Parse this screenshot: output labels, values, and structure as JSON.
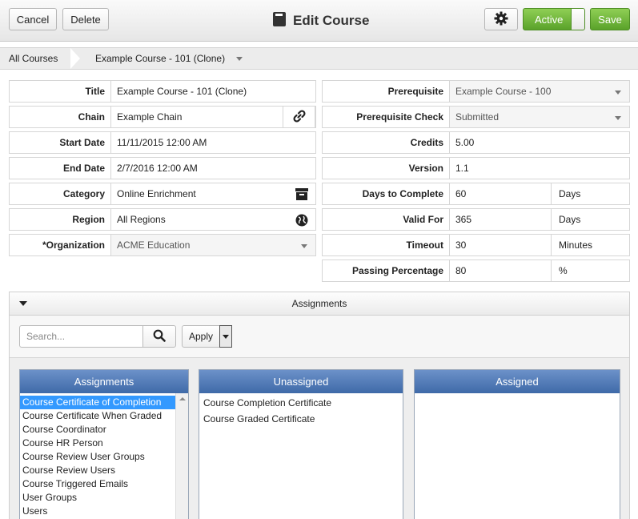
{
  "header": {
    "cancel_label": "Cancel",
    "delete_label": "Delete",
    "title": "Edit Course",
    "active_label": "Active",
    "save_label": "Save"
  },
  "breadcrumb": {
    "root": "All Courses",
    "current": "Example Course - 101 (Clone)"
  },
  "form_left": [
    {
      "label": "Title",
      "value": "Example Course - 101 (Clone)",
      "kind": "text"
    },
    {
      "label": "Chain",
      "value": "Example Chain",
      "kind": "text",
      "icon": "link-icon"
    },
    {
      "label": "Start Date",
      "value": "11/11/2015 12:00 AM",
      "kind": "text"
    },
    {
      "label": "End Date",
      "value": "2/7/2016 12:00 AM",
      "kind": "text"
    },
    {
      "label": "Category",
      "value": "Online Enrichment",
      "kind": "text",
      "icon": "archive-icon"
    },
    {
      "label": "Region",
      "value": "All Regions",
      "kind": "text",
      "icon": "globe-icon"
    },
    {
      "label": "*Organization",
      "value": "ACME Education",
      "kind": "select"
    }
  ],
  "form_right": [
    {
      "label": "Prerequisite",
      "value": "Example Course - 100",
      "kind": "select"
    },
    {
      "label": "Prerequisite Check",
      "value": "Submitted",
      "kind": "select"
    },
    {
      "label": "Credits",
      "value": "5.00",
      "kind": "text"
    },
    {
      "label": "Version",
      "value": "1.1",
      "kind": "text"
    },
    {
      "label": "Days to Complete",
      "value": "60",
      "unit": "Days"
    },
    {
      "label": "Valid For",
      "value": "365",
      "unit": "Days"
    },
    {
      "label": "Timeout",
      "value": "30",
      "unit": "Minutes"
    },
    {
      "label": "Passing Percentage",
      "value": "80",
      "unit": "%"
    }
  ],
  "assignments": {
    "section_title": "Assignments",
    "search_placeholder": "Search...",
    "apply_label": "Apply",
    "panels": {
      "assignments": {
        "title": "Assignments",
        "items": [
          "Course Certificate of Completion",
          "Course Certificate When Graded",
          "Course Coordinator",
          "Course HR Person",
          "Course Review User Groups",
          "Course Review Users",
          "Course Triggered Emails",
          "User Groups",
          "Users"
        ],
        "selected": "Course Certificate of Completion"
      },
      "unassigned": {
        "title": "Unassigned",
        "items": [
          "Course Completion Certificate",
          "Course Graded Certificate"
        ]
      },
      "assigned": {
        "title": "Assigned",
        "items": []
      }
    }
  },
  "colors": {
    "accent_green": "#5aa22a",
    "panel_header_blue": "#3f6aa8",
    "selection_blue": "#3399ff"
  }
}
